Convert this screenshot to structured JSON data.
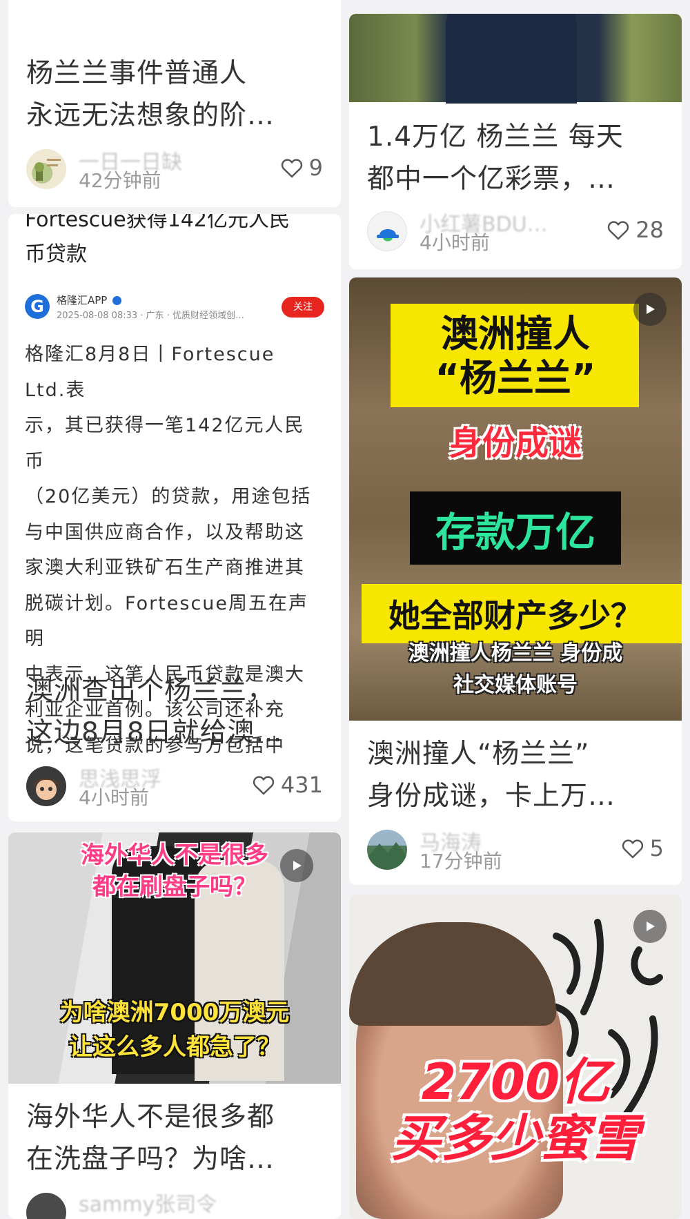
{
  "left_column": {
    "card1": {
      "title_lines": [
        "杨兰兰事件普通人",
        "永远无法想象的阶…"
      ],
      "author_name": "一日一日缺",
      "time": "42分钟前",
      "likes": "9"
    },
    "card2": {
      "header_text_lines": [
        "Fortescue获得142亿元人民",
        "币贷款"
      ],
      "source_name": "格隆汇APP",
      "source_meta": "2025-08-08 08:33 · 广东 · 优质财经领域创…",
      "follow_label": "关注",
      "body_lines": [
        "格隆汇8月8日丨Fortescue Ltd.表",
        "示，其已获得一笔142亿元人民币",
        "（20亿美元）的贷款，用途包括",
        "与中国供应商合作，以及帮助这",
        "家澳大利亚铁矿石生产商推进其",
        "脱碳计划。Fortescue周五在声明",
        "中表示，这笔人民币贷款是澳大",
        "利亚企业首例。该公司还补充",
        "说，这笔贷款的参与方包括中"
      ],
      "title_lines": [
        "澳洲查出个杨兰兰，",
        "这边8月8日就给澳…"
      ],
      "author_name": "思浅思浮",
      "time": "4小时前",
      "likes": "431"
    },
    "card3": {
      "overlay_top": [
        "海外华人不是很多",
        "都在刷盘子吗？"
      ],
      "overlay_bottom": [
        "为啥澳洲7000万澳元",
        "让这么多人都急了？"
      ],
      "title_lines": [
        "海外华人不是很多都",
        "在洗盘子吗？为啥…"
      ],
      "author_name": "sammy张司令"
    }
  },
  "right_column": {
    "card1": {
      "title_lines": [
        "1.4万亿 杨兰兰 每天",
        "都中一个亿彩票，…"
      ],
      "author_name": "小红薯BDU…",
      "time": "4小时前",
      "likes": "28"
    },
    "card2": {
      "cover_title": [
        "澳洲撞人",
        "“杨兰兰”"
      ],
      "cover_red": "身份成谜",
      "cover_green": "存款万亿",
      "cover_question": "她全部财产多少？",
      "cover_subtitle": [
        "澳洲撞人杨兰兰 身份成",
        "社交媒体账号"
      ],
      "title_lines": [
        "澳洲撞人“杨兰兰”",
        "身份成谜，卡上万…"
      ],
      "author_name": "马海涛",
      "time": "17分钟前",
      "likes": "5"
    },
    "card3": {
      "cover_text": [
        "2700亿",
        "买多少蜜雪"
      ]
    }
  },
  "colors": {
    "accent_red": "#ff2442",
    "highlight_yellow": "#f5e000",
    "cover_green": "#2ee59d",
    "source_blue": "#1e6fd9"
  }
}
